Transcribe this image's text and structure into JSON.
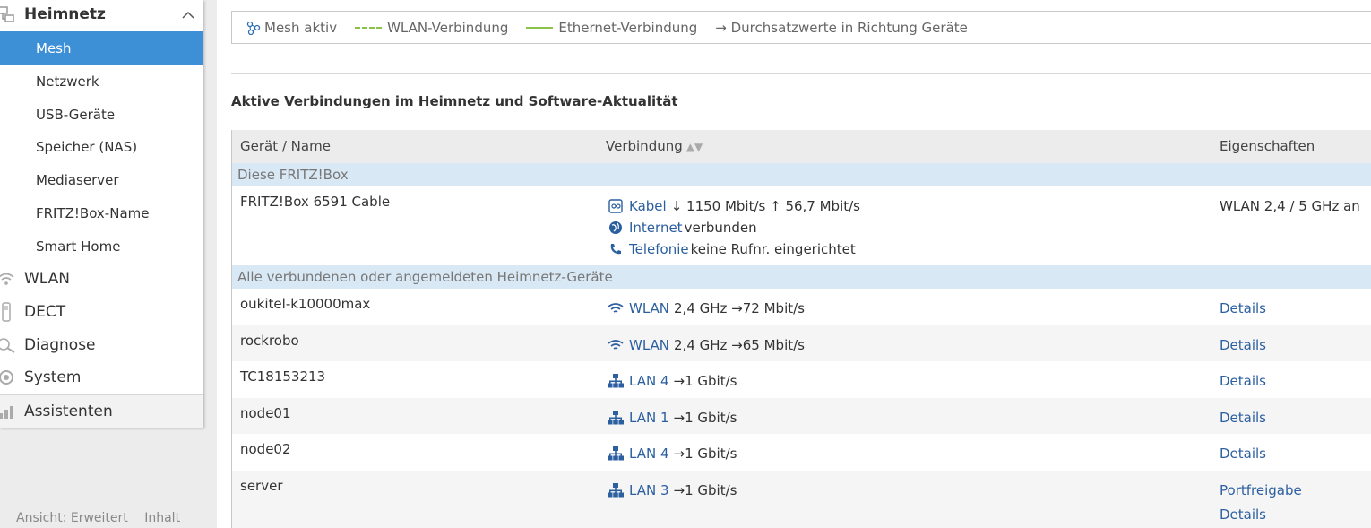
{
  "sidebar": {
    "heimnetz": "Heimnetz",
    "items": [
      "Mesh",
      "Netzwerk",
      "USB-Geräte",
      "Speicher (NAS)",
      "Mediaserver",
      "FRITZ!Box-Name",
      "Smart Home"
    ],
    "wlan": "WLAN",
    "dect": "DECT",
    "diagnose": "Diagnose",
    "system": "System",
    "assistenten": "Assistenten"
  },
  "footer": {
    "view": "Ansicht: Erweitert",
    "content": "Inhalt"
  },
  "legend": {
    "mesh": "Mesh aktiv",
    "wlan": "WLAN-Verbindung",
    "ethernet": "Ethernet-Verbindung",
    "throughput": "→ Durchsatzwerte in Richtung Geräte"
  },
  "section_title": "Aktive Verbindungen im Heimnetz und Software-Aktualität",
  "table": {
    "col_name": "Gerät / Name",
    "col_conn": "Verbindung",
    "col_props": "Eigenschaften",
    "group_box": "Diese FRITZ!Box",
    "box": {
      "name": "FRITZ!Box 6591 Cable",
      "cable_label": "Kabel",
      "cable_value": "↓ 1150 Mbit/s ↑ 56,7 Mbit/s",
      "internet_label": "Internet",
      "internet_value": "verbunden",
      "phone_label": "Telefonie",
      "phone_value": "keine Rufnr. eingerichtet",
      "props": "WLAN 2,4 / 5 GHz an"
    },
    "group_devices": "Alle verbundenen oder angemeldeten Heimnetz-Geräte",
    "devices": [
      {
        "name": "oukitel-k10000max",
        "type": "WLAN",
        "value": "2,4 GHz →72 Mbit/s",
        "link": "Details"
      },
      {
        "name": "rockrobo",
        "type": "WLAN",
        "value": "2,4 GHz →65 Mbit/s",
        "link": "Details"
      },
      {
        "name": "TC18153213",
        "type": "LAN 4",
        "value": "→1 Gbit/s",
        "link": "Details"
      },
      {
        "name": "node01",
        "type": "LAN 1",
        "value": "→1 Gbit/s",
        "link": "Details"
      },
      {
        "name": "node02",
        "type": "LAN 4",
        "value": "→1 Gbit/s",
        "link": "Details"
      },
      {
        "name": "server",
        "type": "LAN 3",
        "value": "→1 Gbit/s",
        "link": "Portfreigabe",
        "link2": "Details"
      }
    ]
  }
}
